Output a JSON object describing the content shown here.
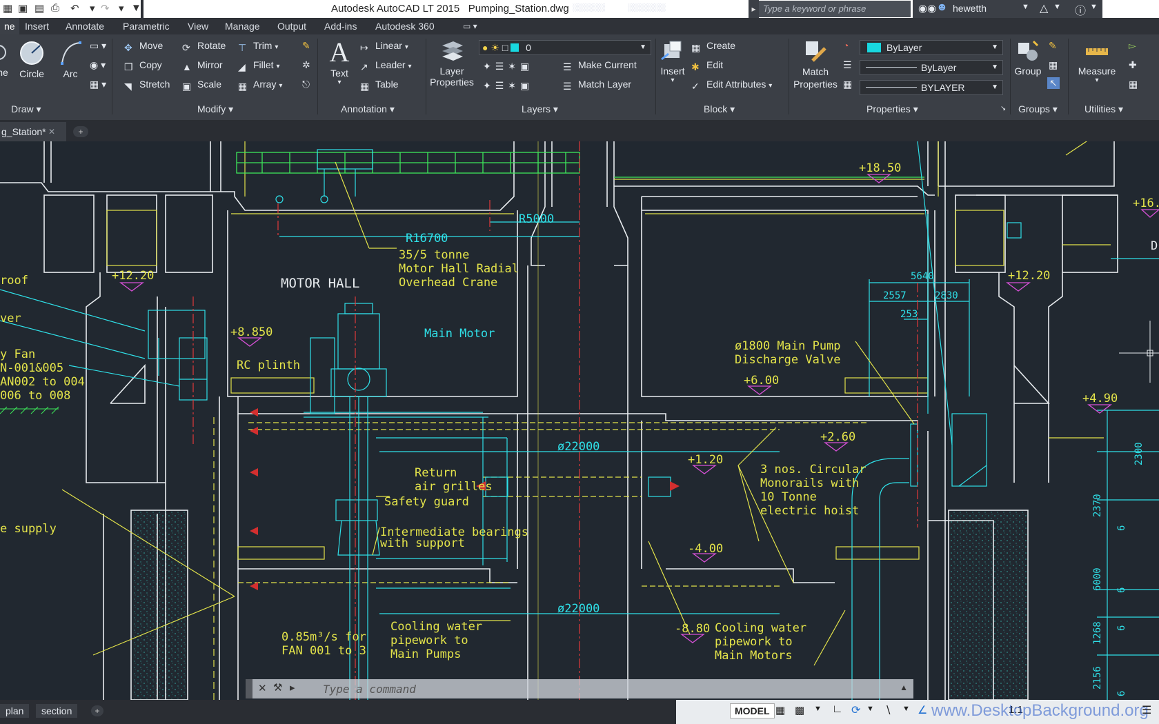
{
  "app": {
    "title": "Autodesk AutoCAD LT 2015",
    "filename": "Pumping_Station.dwg",
    "search_placeholder": "Type a keyword or phrase",
    "user": "hewetth"
  },
  "ribbon_tabs": [
    "ne",
    "Insert",
    "Annotate",
    "Parametric",
    "View",
    "Manage",
    "Output",
    "Add-ins",
    "Autodesk 360"
  ],
  "ribbon": {
    "draw": {
      "label": "Draw",
      "circle": "Circle",
      "arc": "Arc",
      "line": "ne"
    },
    "modify": {
      "label": "Modify",
      "move": "Move",
      "rotate": "Rotate",
      "trim": "Trim",
      "copy": "Copy",
      "mirror": "Mirror",
      "fillet": "Fillet",
      "stretch": "Stretch",
      "scale": "Scale",
      "array": "Array"
    },
    "annotation": {
      "label": "Annotation",
      "text": "Text",
      "linear": "Linear",
      "leader": "Leader",
      "table": "Table"
    },
    "layers": {
      "label": "Layers",
      "layer_properties": "Layer Properties",
      "current_layer": "0",
      "make_current": "Make Current",
      "match_layer": "Match Layer"
    },
    "block": {
      "label": "Block",
      "insert": "Insert",
      "create": "Create",
      "edit": "Edit",
      "edit_attributes": "Edit Attributes"
    },
    "properties": {
      "label": "Properties",
      "match_properties": "Match Properties",
      "color": "ByLayer",
      "linetype": "ByLayer",
      "lineweight": "BYLAYER"
    },
    "groups": {
      "label": "Groups",
      "group": "Group"
    },
    "utilities": {
      "label": "Utilities",
      "measure": "Measure"
    }
  },
  "document_tab": "g_Station*",
  "drawing_labels": {
    "motor_hall": "MOTOR HALL",
    "r16700": "R16700",
    "r5000": "R5000",
    "crane": [
      "35/5 tonne",
      "Motor Hall Radial",
      "Overhead Crane"
    ],
    "main_motor": "Main Motor",
    "rc_plinth": "RC plinth",
    "valve": [
      "ø1800 Main Pump",
      "Discharge Valve"
    ],
    "return_grilles": [
      "Return",
      "air grilles"
    ],
    "safety_guard": "Safety guard",
    "bearings": [
      "Intermediate bearings",
      "with support"
    ],
    "monorails": [
      "3 nos. Circular",
      "Monorails with",
      "10 Tonne",
      "electric hoist"
    ],
    "cooling_left": [
      "Cooling water",
      "pipework to",
      "Main Pumps"
    ],
    "cooling_right": [
      "Cooling water",
      "pipework to",
      "Main Motors"
    ],
    "flow": [
      "0.85m³/s for",
      "FAN 001 to 3"
    ],
    "left_texts": [
      "roof",
      "ver",
      "y Fan",
      "N-001&005",
      "AN002 to 004",
      "006 to 008",
      "e supply"
    ],
    "diam_top": "ø22000",
    "diam_bottom": "ø22000",
    "elevations": [
      "+18.50",
      "+12.20",
      "+12.20",
      "+8.850",
      "+6.00",
      "+2.60",
      "+1.20",
      "-4.00",
      "-8.80",
      "+4.90",
      "+16."
    ],
    "dims_right": [
      "5640",
      "2557",
      "2830",
      "253",
      "2300",
      "2370",
      "6",
      "6000",
      "6",
      "1268",
      "6",
      "2156",
      "6"
    ],
    "edge_letter": "D"
  },
  "command_line": {
    "placeholder": "Type a command"
  },
  "status_bar": {
    "layout_tabs": [
      "plan",
      "section"
    ],
    "model_label": "MODEL",
    "scale": "1:1",
    "watermark": "www.DesktopBackground.org"
  }
}
